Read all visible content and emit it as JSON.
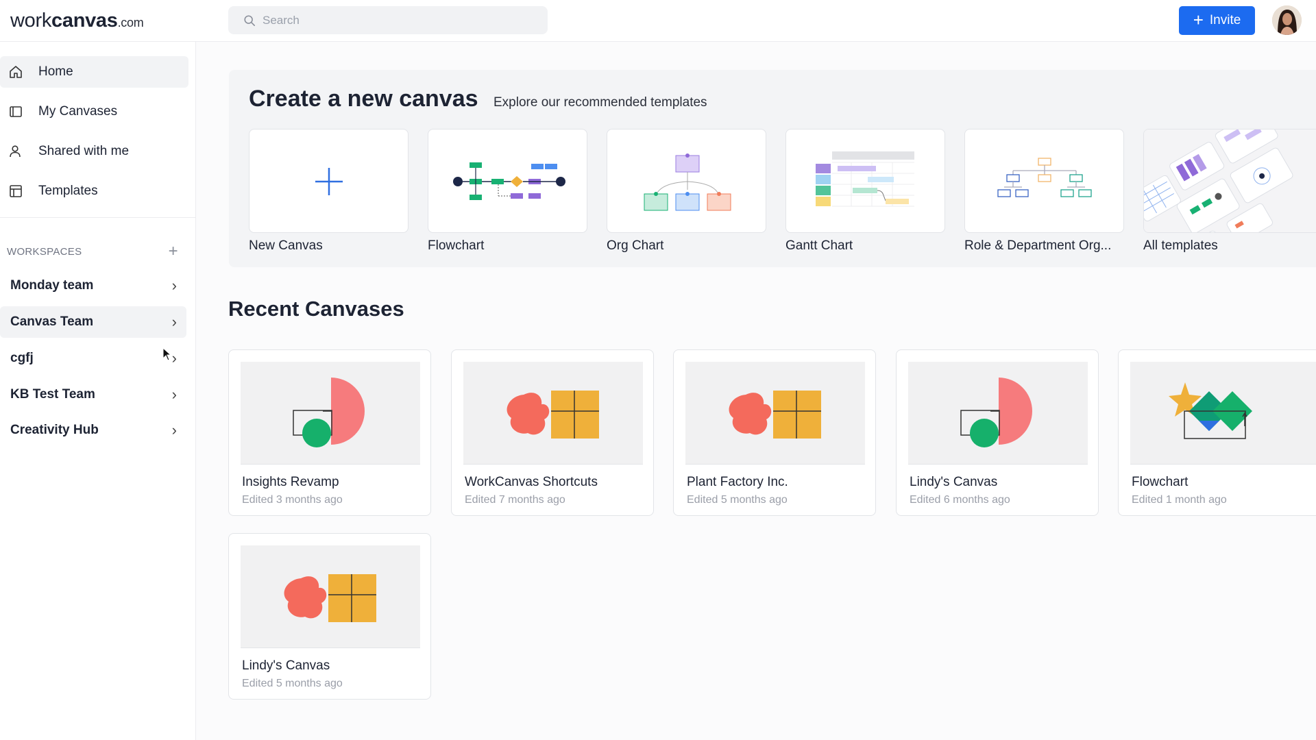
{
  "header": {
    "logo_part1": "work",
    "logo_part2": "canvas",
    "logo_part3": ".com",
    "search_placeholder": "Search",
    "invite_label": "Invite"
  },
  "sidebar": {
    "nav": [
      {
        "label": "Home",
        "icon": "home-icon"
      },
      {
        "label": "My Canvases",
        "icon": "canvas-icon"
      },
      {
        "label": "Shared with me",
        "icon": "user-icon"
      },
      {
        "label": "Templates",
        "icon": "template-icon"
      }
    ],
    "workspaces_heading": "WORKSPACES",
    "workspaces": [
      {
        "label": "Monday team"
      },
      {
        "label": "Canvas Team"
      },
      {
        "label": "cgfj"
      },
      {
        "label": "KB Test Team"
      },
      {
        "label": "Creativity Hub"
      }
    ]
  },
  "templates": {
    "title": "Create a new canvas",
    "subtitle": "Explore our recommended templates",
    "items": [
      {
        "label": "New Canvas"
      },
      {
        "label": "Flowchart"
      },
      {
        "label": "Org Chart"
      },
      {
        "label": "Gantt Chart"
      },
      {
        "label": "Role & Department Org..."
      },
      {
        "label": "All templates"
      }
    ]
  },
  "recent": {
    "title": "Recent Canvases",
    "items": [
      {
        "name": "Insights Revamp",
        "edited": "Edited 3 months ago",
        "thumb": "arc-circle"
      },
      {
        "name": "WorkCanvas Shortcuts",
        "edited": "Edited 7 months ago",
        "thumb": "blob-grid"
      },
      {
        "name": "Plant Factory Inc.",
        "edited": "Edited 5 months ago",
        "thumb": "blob-grid"
      },
      {
        "name": "Lindy's Canvas",
        "edited": "Edited 6 months ago",
        "thumb": "arc-circle"
      },
      {
        "name": "Flowchart",
        "edited": "Edited 1 month ago",
        "thumb": "star-diamond"
      },
      {
        "name": "Lindy's Canvas",
        "edited": "Edited 5 months ago",
        "thumb": "blob-grid"
      }
    ]
  },
  "colors": {
    "accent": "#1c6bf0",
    "green": "#16b06b",
    "coral": "#f46a5c",
    "yellow": "#efb03a"
  }
}
